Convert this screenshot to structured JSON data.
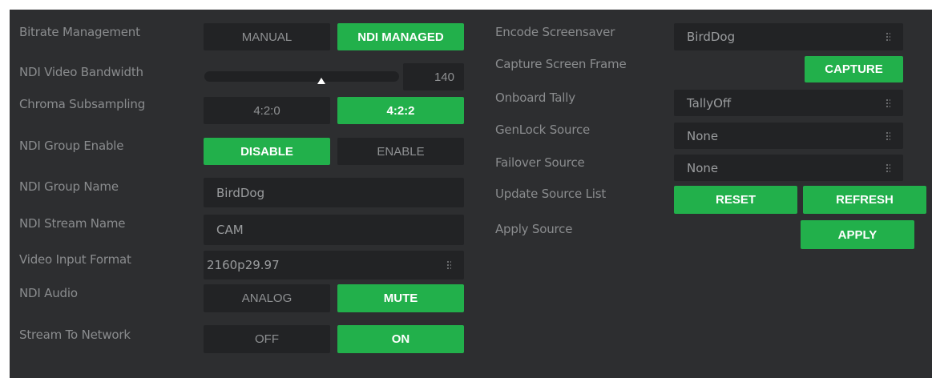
{
  "left": {
    "bitrate_management": {
      "label": "Bitrate Management",
      "options": [
        "MANUAL",
        "NDI MANAGED"
      ],
      "selected": "NDI MANAGED"
    },
    "ndi_video_bandwidth": {
      "label": "NDI Video Bandwidth",
      "value": "140",
      "slider_fraction": 0.6
    },
    "chroma_subsampling": {
      "label": "Chroma Subsampling",
      "options": [
        "4:2:0",
        "4:2:2"
      ],
      "selected": "4:2:2"
    },
    "ndi_group_enable": {
      "label": "NDI Group Enable",
      "options": [
        "DISABLE",
        "ENABLE"
      ],
      "selected": "DISABLE"
    },
    "ndi_group_name": {
      "label": "NDI Group Name",
      "value": "BirdDog"
    },
    "ndi_stream_name": {
      "label": "NDI Stream Name",
      "value": "CAM"
    },
    "video_input_format": {
      "label": "Video Input Format",
      "value": "2160p29.97",
      "icon": "drag-handle-icon"
    },
    "ndi_audio": {
      "label": "NDI Audio",
      "options": [
        "ANALOG",
        "MUTE"
      ],
      "selected": "MUTE"
    },
    "stream_to_network": {
      "label": "Stream To Network",
      "options": [
        "OFF",
        "ON"
      ],
      "selected": "ON"
    }
  },
  "right": {
    "encode_screensaver": {
      "label": "Encode Screensaver",
      "value": "BirdDog",
      "icon": "drag-handle-icon"
    },
    "capture_screen_frame": {
      "label": "Capture Screen Frame",
      "button": "CAPTURE"
    },
    "onboard_tally": {
      "label": "Onboard Tally",
      "value": "TallyOff",
      "icon": "drag-handle-icon"
    },
    "genlock_source": {
      "label": "GenLock Source",
      "value": "None",
      "icon": "drag-handle-icon"
    },
    "failover_source": {
      "label": "Failover Source",
      "value": "None",
      "icon": "drag-handle-icon"
    },
    "update_source_list": {
      "label": "Update Source List",
      "buttons": [
        "RESET",
        "REFRESH"
      ]
    },
    "apply_source": {
      "label": "Apply Source",
      "button": "APPLY"
    }
  },
  "colors": {
    "background": "#2d2e30",
    "control": "#222325",
    "accent_green": "#22b04b",
    "label_text": "#8a8c8e",
    "button_text_on": "#ffffff"
  }
}
